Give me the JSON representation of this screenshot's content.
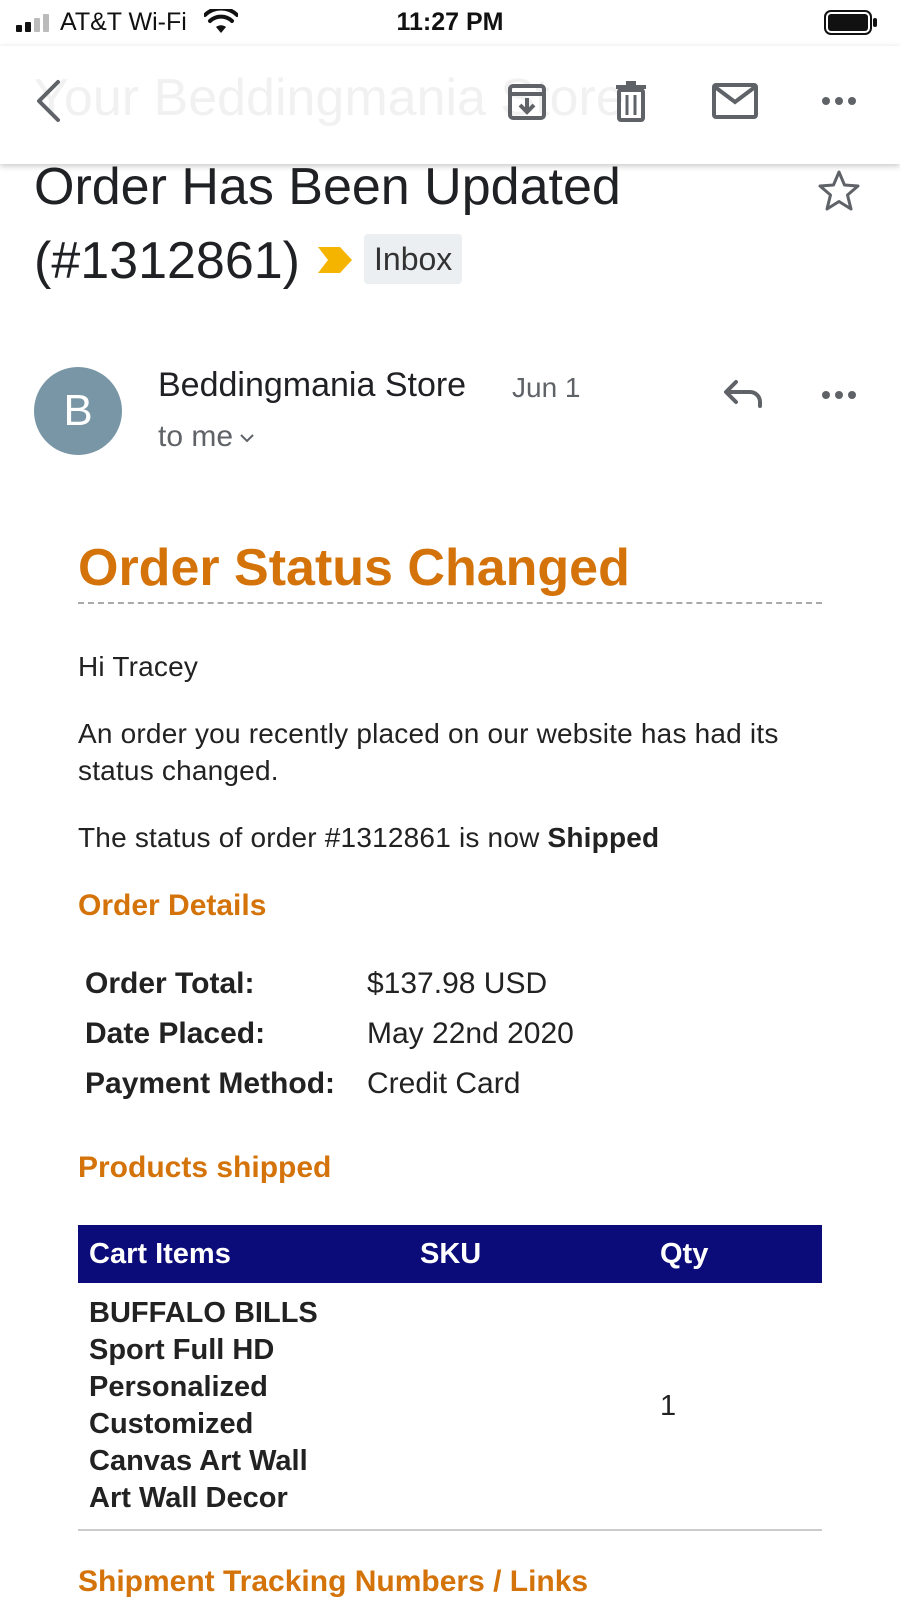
{
  "status_bar": {
    "carrier": "AT&T Wi-Fi",
    "time": "11:27 PM"
  },
  "action_bar": {
    "ghost_title": "Your Beddingmania Store"
  },
  "subject": {
    "line1": "Order Has Been Updated",
    "line2": "(#1312861)",
    "label": "Inbox",
    "label_marker_color": "#f4b400"
  },
  "sender": {
    "initial": "B",
    "name": "Beddingmania Store",
    "date": "Jun 1",
    "recipient": "to me",
    "avatar_color": "#7896a6"
  },
  "email": {
    "heading": "Order Status Changed",
    "greeting": "Hi Tracey",
    "intro": "An order you recently placed on our website has had its status changed.",
    "status_prefix": "The status of order #1312861 is now ",
    "status_value": "Shipped",
    "details_heading": "Order Details",
    "details": [
      {
        "label": "Order Total:",
        "value": "$137.98 USD"
      },
      {
        "label": "Date Placed:",
        "value": "May 22nd 2020"
      },
      {
        "label": "Payment Method:",
        "value": "Credit Card"
      }
    ],
    "products_heading": "Products shipped",
    "table": {
      "headers": {
        "item": "Cart Items",
        "sku": "SKU",
        "qty": "Qty"
      },
      "rows": [
        {
          "item_lines": [
            "BUFFALO BILLS",
            "Sport Full HD",
            "Personalized",
            "Customized",
            "Canvas Art Wall",
            "Art Wall Decor"
          ],
          "sku": "",
          "qty": "1"
        }
      ]
    },
    "tracking_heading": "Shipment Tracking Numbers / Links",
    "accent_color": "#d4730a",
    "table_header_color": "#0b0b7a"
  }
}
